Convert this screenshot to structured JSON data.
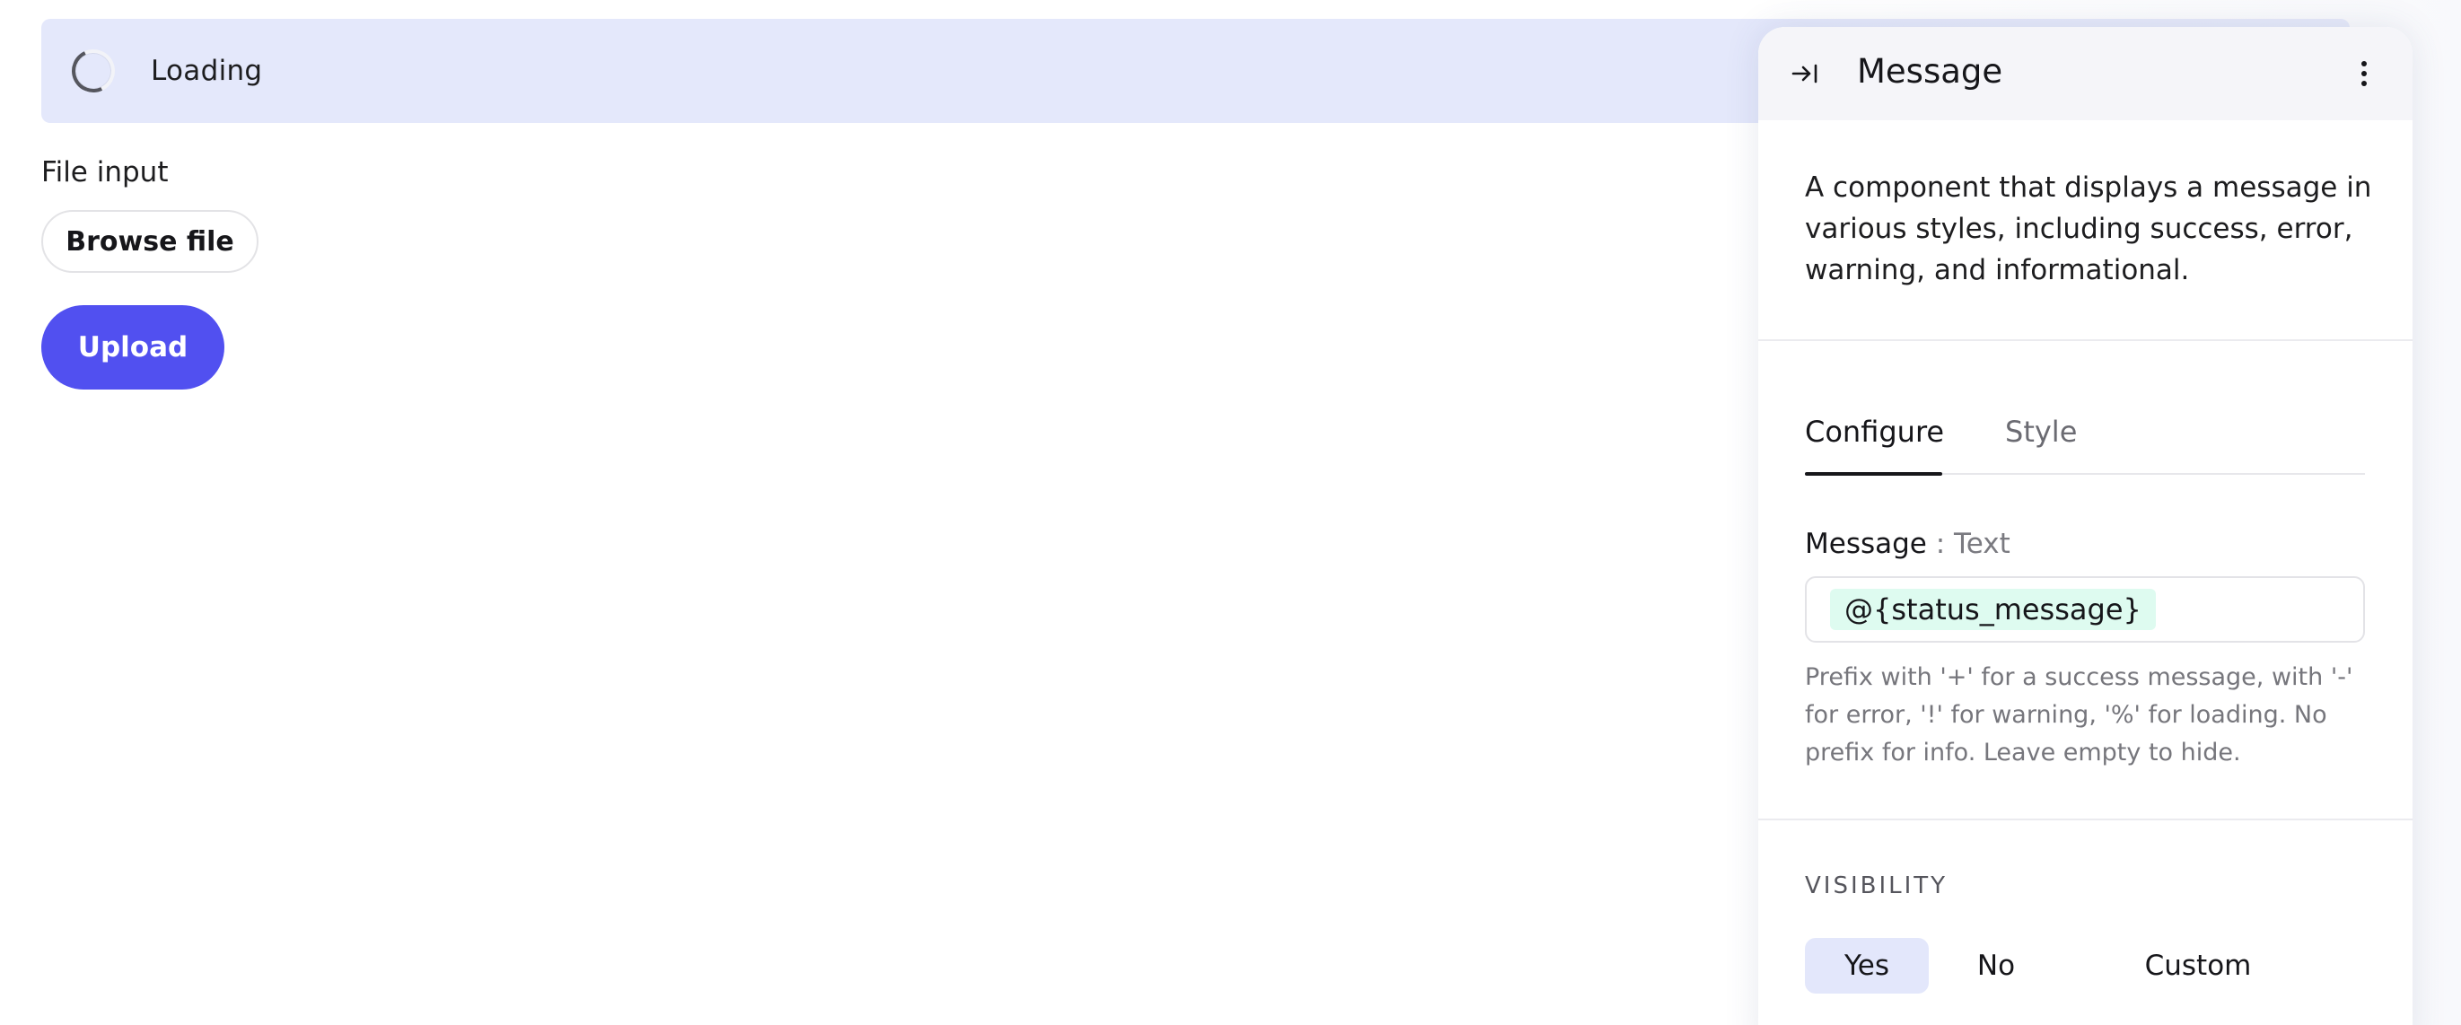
{
  "loading_banner": {
    "text": "Loading"
  },
  "file_input": {
    "label": "File input",
    "browse_label": "Browse file"
  },
  "upload_button": {
    "label": "Upload"
  },
  "panel": {
    "title": "Message",
    "description": "A component that displays a message in various styles, including success, error, warning, and informational.",
    "tabs": [
      {
        "label": "Configure",
        "active": true
      },
      {
        "label": "Style",
        "active": false
      }
    ],
    "message_field": {
      "label": "Message",
      "type_label": ": Text",
      "value": "@{status_message}",
      "help": "Prefix with '+' for a success message, with '-' for error, '!' for warning, '%' for loading. No prefix for info. Leave empty to hide."
    },
    "visibility": {
      "heading": "VISIBILITY",
      "options": [
        {
          "label": "Yes",
          "selected": true
        },
        {
          "label": "No",
          "selected": false
        },
        {
          "label": "Custom",
          "selected": false
        }
      ]
    }
  },
  "icons": {
    "spinner": "loading-spinner-icon",
    "collapse": "collapse-panel-icon",
    "menu": "kebab-menu-icon"
  },
  "colors": {
    "banner_bg": "#e4e8fb",
    "primary": "#5150f0",
    "token_bg": "#defbf0",
    "selected_seg": "#e3e7fb"
  }
}
